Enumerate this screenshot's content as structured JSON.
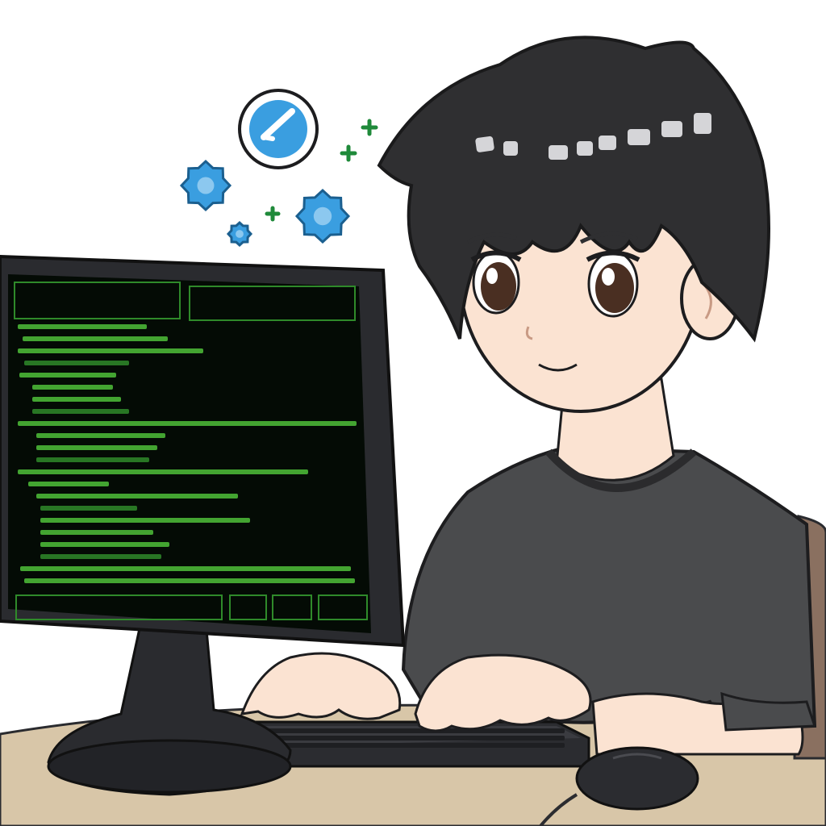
{
  "scene": {
    "colors": {
      "background": "#ffffff",
      "desk": "#d8c6a8",
      "monitor_frame": "#2a2b2f",
      "screen": "#040b05",
      "terminal_green": "#4fbf3a",
      "terminal_dim_green": "#2f8a2a",
      "shirt": "#4a4b4d",
      "hair": "#2f2f31",
      "skin": "#fbe3d2",
      "eyes": "#4a2f22",
      "gear_blue": "#3a9ee0",
      "plus_green": "#1f8a3a",
      "chair": "#8a7060"
    },
    "icons": [
      "check-badge-icon",
      "gear-icon",
      "plus-icon"
    ],
    "terminal": {
      "code_line_count": 22
    }
  }
}
